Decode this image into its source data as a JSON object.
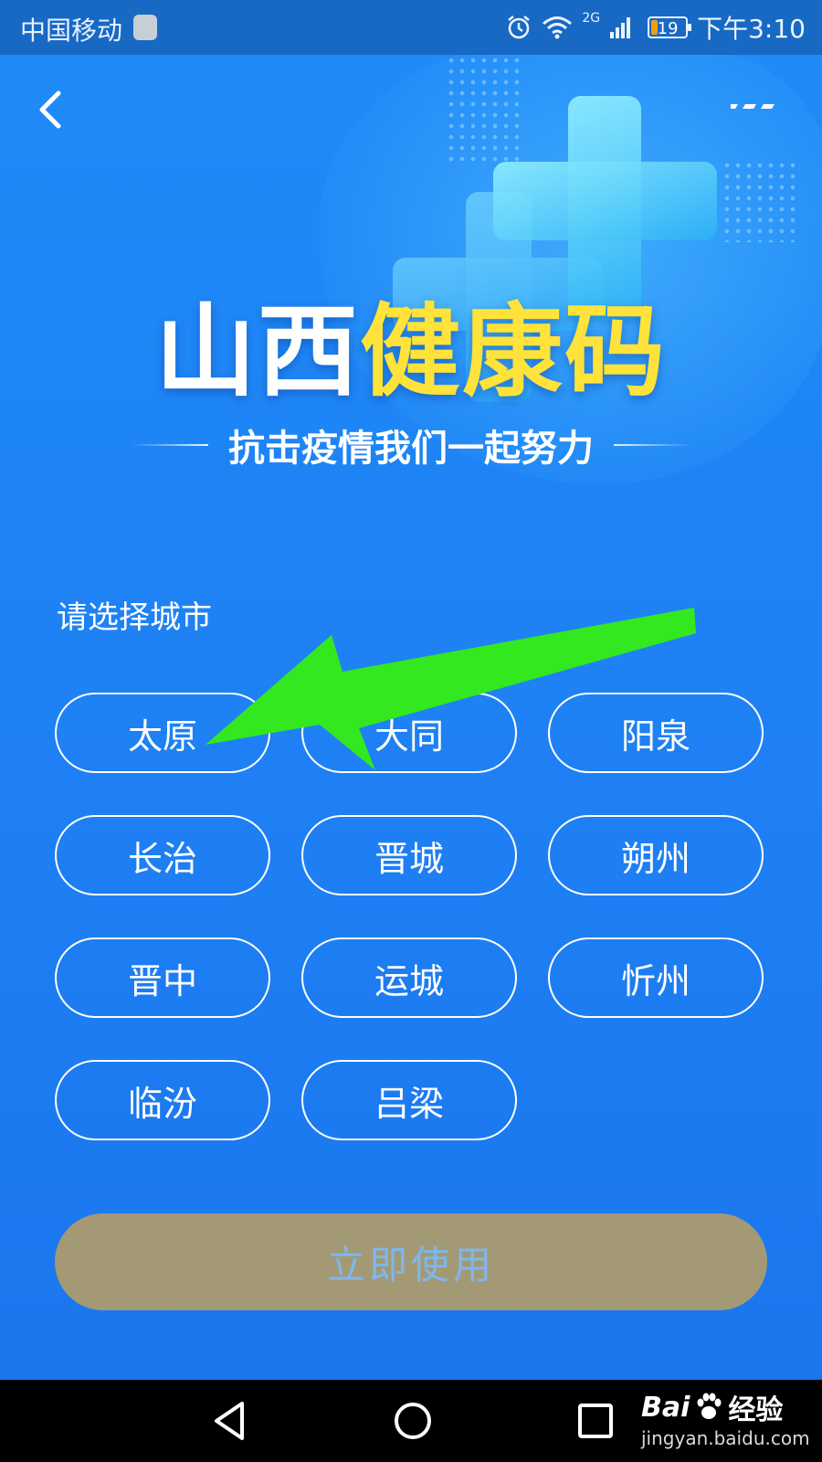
{
  "status_bar": {
    "carrier": "中国移动",
    "network": "2G",
    "battery": "19",
    "battery_fraction": 0.19,
    "time": "下午3:10"
  },
  "header": {
    "back_icon": "chevron-left-icon",
    "more_icon": "more-dots-icon"
  },
  "banner": {
    "title_part1": "山西",
    "title_part2": "健康码",
    "subtitle": "抗击疫情我们一起努力"
  },
  "city_select": {
    "label": "请选择城市",
    "cities": [
      "太原",
      "大同",
      "阳泉",
      "长治",
      "晋城",
      "朔州",
      "晋中",
      "运城",
      "忻州",
      "临汾",
      "吕梁"
    ]
  },
  "action": {
    "use_label": "立即使用"
  },
  "watermark": {
    "brand": "Bai",
    "brand_suffix": "经验",
    "url": "jingyan.baidu.com"
  },
  "colors": {
    "background": "#1e86f5",
    "title_yellow": "#ffe23a",
    "button_disabled": "#a39a75",
    "annotation_arrow": "#33e81f"
  }
}
